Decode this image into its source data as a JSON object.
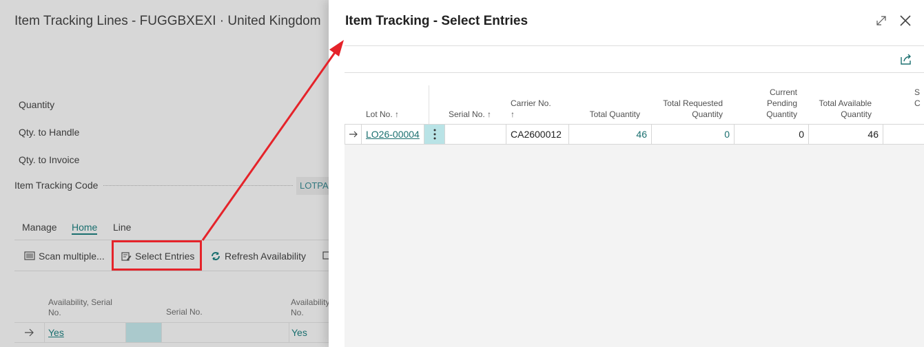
{
  "background": {
    "title": "Item Tracking Lines - FUGGBXEXI · United Kingdom",
    "fields": {
      "quantity": "Quantity",
      "qty_to_handle": "Qty. to Handle",
      "qty_to_invoice": "Qty. to Invoice",
      "item_tracking_code_label": "Item Tracking Code",
      "item_tracking_code_value": "LOTPAC"
    },
    "tabs": [
      "Manage",
      "Home",
      "Line"
    ],
    "actions": {
      "scan_multiple": "Scan multiple...",
      "select_entries": "Select Entries",
      "refresh_availability": "Refresh Availability"
    },
    "columns": {
      "availability_serial": "Availability, Serial No.",
      "serial_no": "Serial No.",
      "availability_lot": "Availability No."
    },
    "row": {
      "availability_serial": "Yes",
      "availability_lot": "Yes"
    }
  },
  "dialog": {
    "title": "Item Tracking - Select Entries",
    "columns": {
      "lot_no": "Lot No. ↑",
      "serial_no": "Serial No. ↑",
      "carrier_no": "Carrier No.",
      "carrier_no_sort": "↑",
      "total_quantity": "Total Quantity",
      "total_requested_1": "Total Requested",
      "total_requested_2": "Quantity",
      "current_pending_1": "Current",
      "current_pending_2": "Pending",
      "current_pending_3": "Quantity",
      "total_available_1": "Total Available",
      "total_available_2": "Quantity",
      "partial_1": "S",
      "partial_2": "C"
    },
    "rows": [
      {
        "lot_no": "LO26-00004",
        "serial_no": "",
        "carrier_no": "CA2600012",
        "total_quantity": "46",
        "total_requested_quantity": "0",
        "current_pending_quantity": "0",
        "total_available_quantity": "46"
      }
    ]
  },
  "colors": {
    "accent": "#1a6f6f",
    "highlight": "#e5232a",
    "selected_cell": "#b9e3e6"
  }
}
